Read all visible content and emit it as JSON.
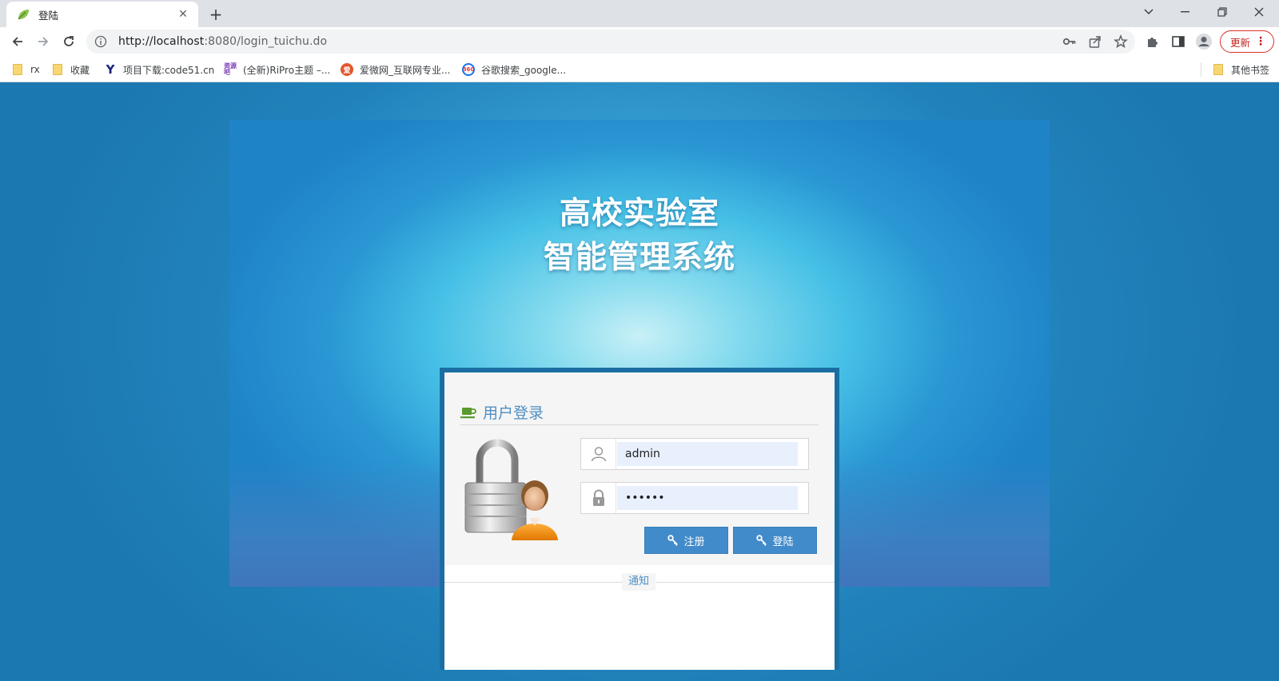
{
  "browser": {
    "tab_title": "登陆",
    "url_host": "http://localhost",
    "url_rest": ":8080/login_tuichu.do",
    "update_label": "更新",
    "bookmarks": [
      {
        "label": "rx",
        "icon": "folder-icon"
      },
      {
        "label": "收藏",
        "icon": "folder-icon"
      },
      {
        "label": "项目下载:code51.cn",
        "icon": "y-logo-icon"
      },
      {
        "label": "(全新)RiPro主题 –...",
        "icon": "purple-site-icon"
      },
      {
        "label": "爱微网_互联网专业...",
        "icon": "aiwei-icon"
      },
      {
        "label": "谷歌搜索_google...",
        "icon": "360-icon"
      }
    ],
    "other_bookmarks": "其他书签"
  },
  "page": {
    "title_line1": "高校实验室",
    "title_line2": "智能管理系统",
    "login_heading": "用户登录",
    "username_value": "admin",
    "password_value": "••••••",
    "register_label": "注册",
    "login_label": "登陆",
    "notice_label": "通知"
  },
  "colors": {
    "brand_blue": "#428bca",
    "heading_blue": "#4f8ec2",
    "frame_blue": "#1b6ea3",
    "cup_green": "#5a9a2f"
  }
}
